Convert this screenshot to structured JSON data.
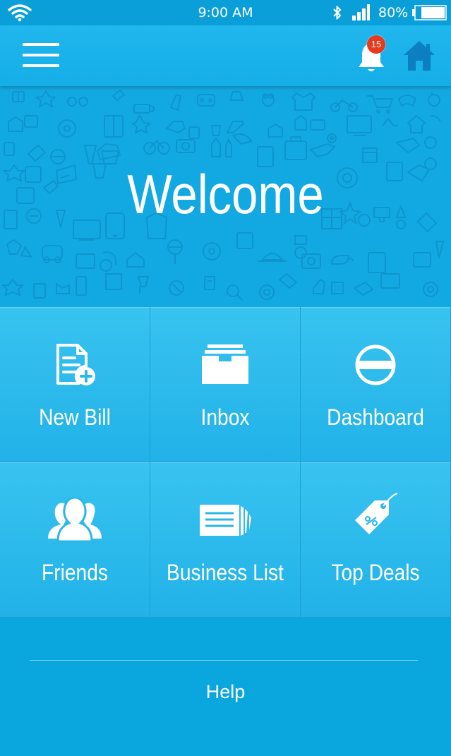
{
  "status_bar": {
    "time": "9:00 AM",
    "battery_percent": "80%",
    "icons": [
      "wifi-icon",
      "bluetooth-icon",
      "signal-icon",
      "battery-icon"
    ]
  },
  "app_bar": {
    "notification_count": "15",
    "icons": [
      "menu-icon",
      "bell-icon",
      "home-icon"
    ]
  },
  "banner": {
    "title": "Welcome"
  },
  "tiles": [
    {
      "label": "New Bill",
      "icon": "new-bill-icon"
    },
    {
      "label": "Inbox",
      "icon": "inbox-icon"
    },
    {
      "label": "Dashboard",
      "icon": "dashboard-icon"
    },
    {
      "label": "Friends",
      "icon": "friends-icon"
    },
    {
      "label": "Business List",
      "icon": "business-list-icon"
    },
    {
      "label": "Top Deals",
      "icon": "top-deals-icon"
    }
  ],
  "footer": {
    "help_label": "Help"
  },
  "colors": {
    "primary": "#0ba5dd",
    "tile": "#2bb8ec",
    "badge": "#e8391d",
    "home_icon": "#0b7fc0"
  }
}
